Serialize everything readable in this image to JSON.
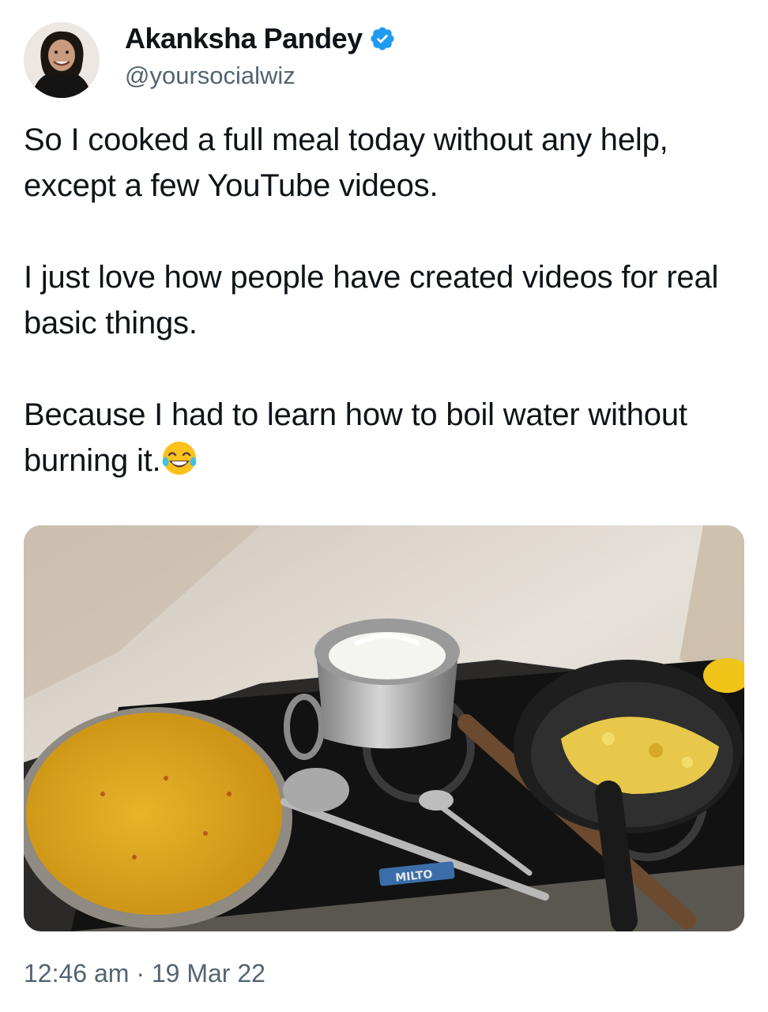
{
  "author": {
    "display_name": "Akanksha Pandey",
    "handle": "@yoursocialwiz",
    "verified_icon": "verified-badge-icon",
    "verified_color": "#1d9bf0"
  },
  "tweet": {
    "paragraphs": [
      "So I cooked a full meal today without any help, except a few YouTube videos.",
      "I just love how people have created videos for real basic things.",
      "Because I had to learn how to boil water without burning it."
    ],
    "emoji": "face-with-tears-of-joy-icon"
  },
  "media": {
    "stove_brand": "MILTO"
  },
  "meta": {
    "timestamp": "12:46 am · 19 Mar 22"
  },
  "colors": {
    "text_primary": "#0f1419",
    "text_secondary": "#536471"
  }
}
